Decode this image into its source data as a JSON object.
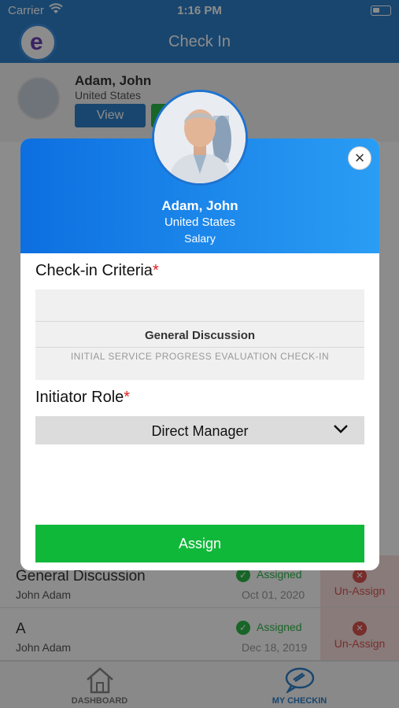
{
  "status_bar": {
    "carrier": "Carrier",
    "time": "1:16 PM"
  },
  "nav": {
    "title": "Check In",
    "logo_letter": "e"
  },
  "employee_card": {
    "name": "Adam, John",
    "country": "United States",
    "view_label": "View"
  },
  "list": [
    {
      "title": "General Discussion",
      "subtitle": "John Adam",
      "status": "Assigned",
      "date": "Oct 01, 2020",
      "action": "Un-Assign"
    },
    {
      "title": "A",
      "subtitle": "John Adam",
      "status": "Assigned",
      "date": "Dec 18, 2019",
      "action": "Un-Assign"
    }
  ],
  "tabs": [
    {
      "label": "DASHBOARD",
      "icon": "home-icon",
      "active": false
    },
    {
      "label": "MY CHECKIN",
      "icon": "checkin-icon",
      "active": true
    }
  ],
  "modal": {
    "employee_name": "Adam, John",
    "country": "United States",
    "pay_type": "Salary",
    "criteria_label": "Check-in Criteria",
    "required_mark": "*",
    "criteria_name": "General Discussion",
    "criteria_description": "INITIAL SERVICE PROGRESS EVALUATION CHECK-IN",
    "role_label": "Initiator Role",
    "role_value": "Direct Manager",
    "assign_label": "Assign"
  },
  "colors": {
    "primary_blue": "#2f80c9",
    "modal_gradient_start": "#0d6fe0",
    "modal_gradient_end": "#2a9df4",
    "assign_green": "#10b83a",
    "required_red": "#e02020",
    "active_tab": "#2f80c9"
  }
}
